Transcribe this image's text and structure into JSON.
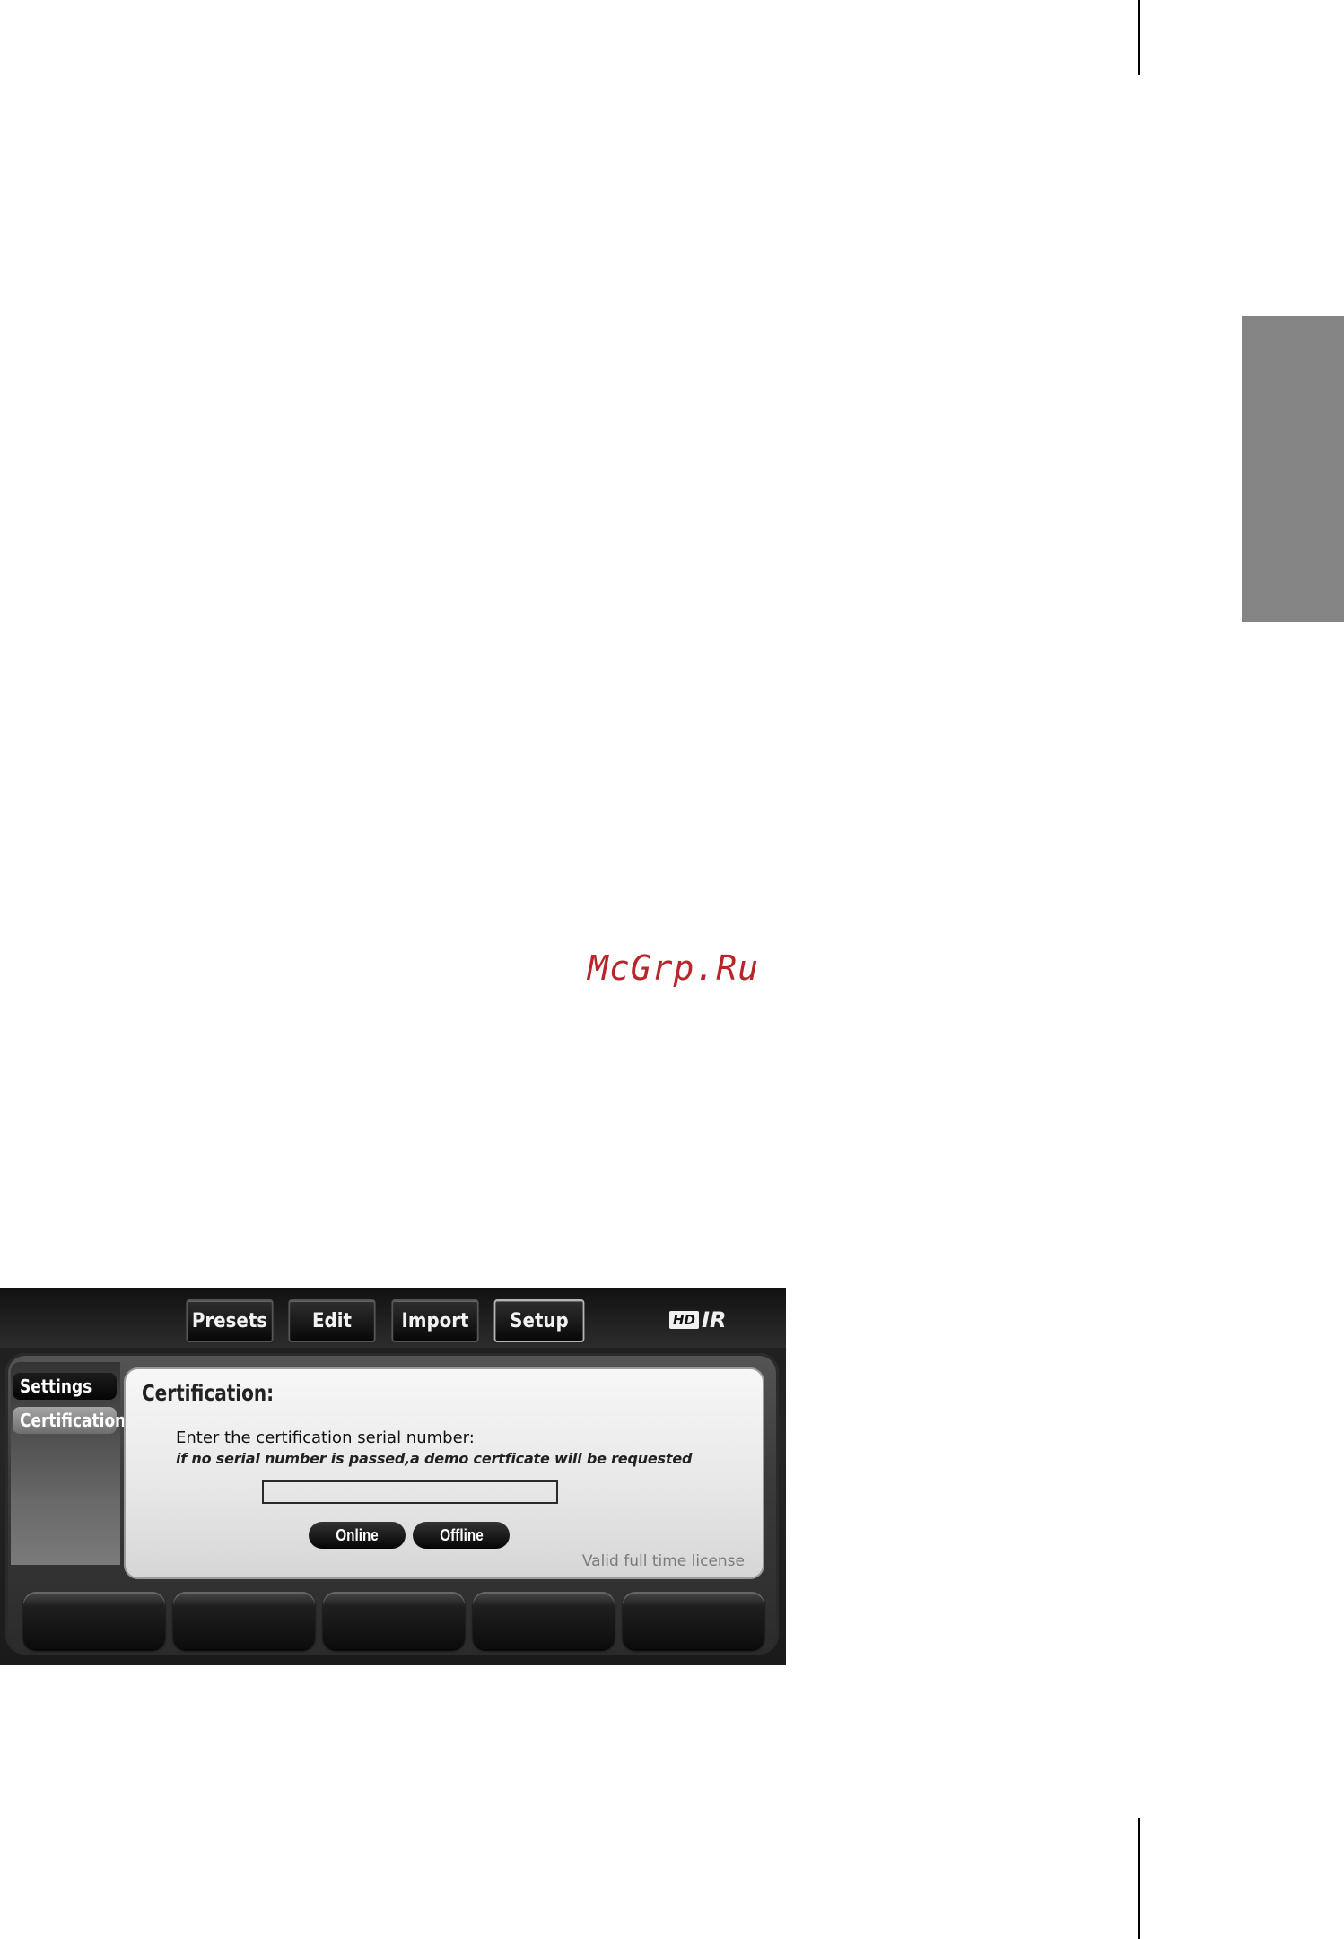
{
  "page": {
    "watermark": "McGrp.Ru"
  },
  "plugin": {
    "nav": {
      "presets": "Presets",
      "edit": "Edit",
      "import": "Import",
      "setup": "Setup",
      "active": "Setup"
    },
    "brand": {
      "hd": "HD",
      "ir": "IR"
    },
    "sidebar": {
      "items": [
        {
          "label": "Settings"
        },
        {
          "label": "Certification"
        }
      ],
      "selected": "Certification"
    },
    "certification": {
      "title": "Certification:",
      "prompt": "Enter the certification serial number:",
      "hint": "if no serial number is passed,a demo certficate will be requested",
      "serial_value": "",
      "online_label": "Online",
      "offline_label": "Offline",
      "license_status": "Valid full time license"
    },
    "soft_buttons_count": 5
  },
  "colors": {
    "watermark": "#b8262b",
    "side_tab": "#848484",
    "panel_bg": "#e8e8e8",
    "button_bg": "#0c0c0c",
    "license_text": "#7a7a7a"
  }
}
